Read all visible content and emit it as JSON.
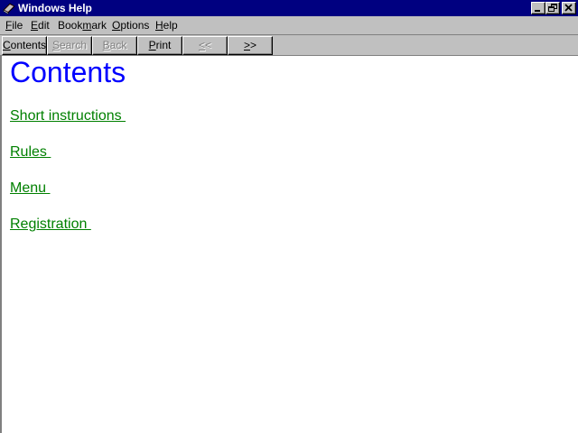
{
  "window": {
    "title": "Windows Help",
    "icon": "help-book-icon"
  },
  "caption_buttons": {
    "minimize": "minimize-icon",
    "restore": "restore-icon",
    "close": "close-icon"
  },
  "menubar": {
    "items": [
      {
        "pre": "",
        "key": "F",
        "post": "ile"
      },
      {
        "pre": "",
        "key": "E",
        "post": "dit"
      },
      {
        "pre": "Book",
        "key": "m",
        "post": "ark"
      },
      {
        "pre": "",
        "key": "O",
        "post": "ptions"
      },
      {
        "pre": "",
        "key": "H",
        "post": "elp"
      }
    ]
  },
  "toolbar": {
    "buttons": [
      {
        "pre": "",
        "key": "C",
        "post": "ontents",
        "enabled": true
      },
      {
        "pre": "",
        "key": "S",
        "post": "earch",
        "enabled": false
      },
      {
        "pre": "",
        "key": "B",
        "post": "ack",
        "enabled": false
      },
      {
        "pre": "",
        "key": "P",
        "post": "rint",
        "enabled": true
      },
      {
        "pre": "",
        "key": "<",
        "post": "<",
        "enabled": false
      },
      {
        "pre": "",
        "key": ">",
        "post": ">",
        "enabled": true
      }
    ]
  },
  "content": {
    "title": "Contents",
    "links": [
      "Short instructions ",
      "Rules ",
      "Menu ",
      "Registration "
    ]
  },
  "colors": {
    "titlebar": "#000080",
    "title_text": "#0000ff",
    "link": "#008000"
  }
}
